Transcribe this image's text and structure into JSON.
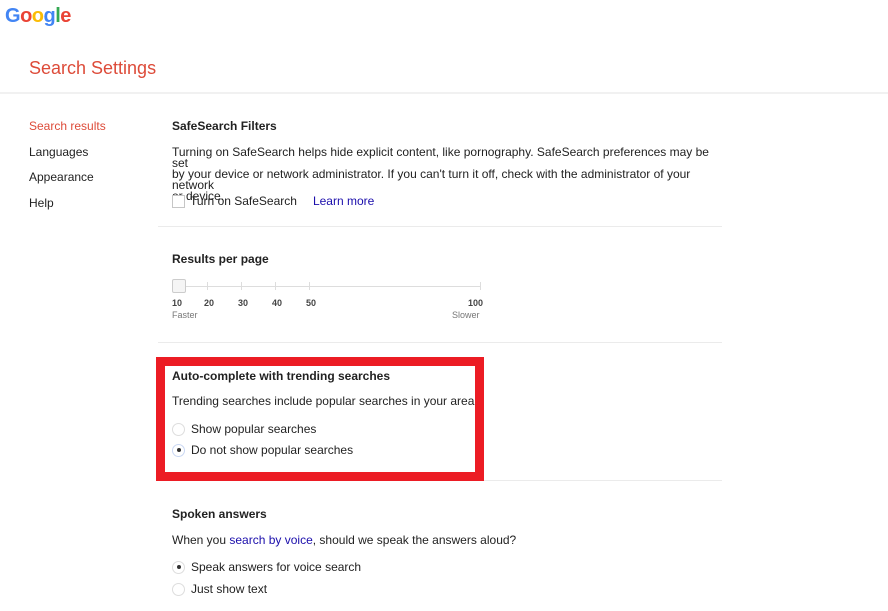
{
  "brand": {
    "logo_letters": [
      {
        "char": "G",
        "color": "#4285f4"
      },
      {
        "char": "o",
        "color": "#ea4335"
      },
      {
        "char": "o",
        "color": "#fbbc05"
      },
      {
        "char": "g",
        "color": "#4285f4"
      },
      {
        "char": "l",
        "color": "#34a853"
      },
      {
        "char": "e",
        "color": "#ea4335"
      }
    ],
    "accent_color": "#dd4b39"
  },
  "header": {
    "title": "Search Settings"
  },
  "sidebar": {
    "items": [
      {
        "label": "Search results",
        "active": true
      },
      {
        "label": "Languages",
        "active": false
      },
      {
        "label": "Appearance",
        "active": false
      },
      {
        "label": "Help",
        "active": false
      }
    ]
  },
  "safesearch": {
    "title": "SafeSearch Filters",
    "description_lines": [
      "Turning on SafeSearch helps hide explicit content, like pornography. SafeSearch preferences may be set",
      "by your device or network administrator. If you can't turn it off, check with the administrator of your network",
      "or device."
    ],
    "checkbox_label": "Turn on SafeSearch",
    "checked": false,
    "learn_more": "Learn more"
  },
  "results_per_page": {
    "title": "Results per page",
    "options": [
      "10",
      "20",
      "30",
      "40",
      "50",
      "100"
    ],
    "selected": "10",
    "left_caption": "Faster",
    "right_caption": "Slower"
  },
  "autocomplete": {
    "title": "Auto-complete with trending searches",
    "description": "Trending searches include popular searches in your area.",
    "options": [
      {
        "label": "Show popular searches",
        "checked": false
      },
      {
        "label": "Do not show popular searches",
        "checked": true
      }
    ],
    "highlight_color": "#ec1c24"
  },
  "spoken_answers": {
    "title": "Spoken answers",
    "description_prefix": "When you ",
    "description_link": "search by voice",
    "description_suffix": ", should we speak the answers aloud?",
    "options": [
      {
        "label": "Speak answers for voice search",
        "checked": true
      },
      {
        "label": "Just show text",
        "checked": false
      }
    ]
  }
}
